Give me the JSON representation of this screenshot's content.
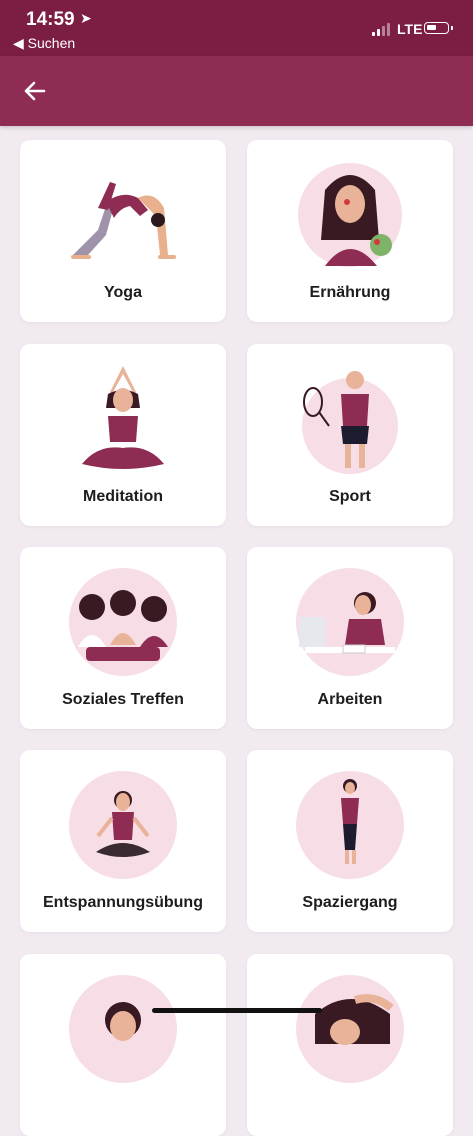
{
  "status_bar": {
    "time": "14:59",
    "location_glyph": "➤",
    "back_app_label": "◀ Suchen",
    "network": "LTE"
  },
  "nav": {
    "back_icon": "arrow-left-icon"
  },
  "categories": [
    {
      "label": "Yoga"
    },
    {
      "label": "Ernährung"
    },
    {
      "label": "Meditation"
    },
    {
      "label": "Sport"
    },
    {
      "label": "Soziales Treffen"
    },
    {
      "label": "Arbeiten"
    },
    {
      "label": "Entspannungsübung"
    },
    {
      "label": "Spaziergang"
    },
    {
      "label": ""
    },
    {
      "label": ""
    }
  ],
  "colors": {
    "status_bar": "#7c1d44",
    "header": "#8e2c53",
    "background": "#f1ebf1",
    "accent": "#8e2c53",
    "circle": "#f7dde6"
  }
}
